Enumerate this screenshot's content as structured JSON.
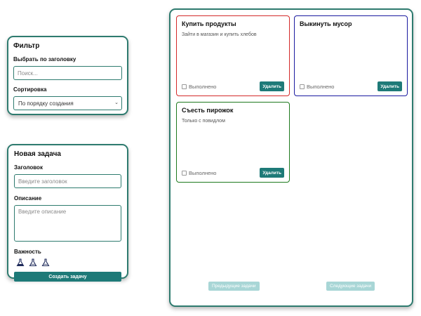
{
  "filter": {
    "title": "Фильтр",
    "search_label": "Выбрать по заголовку",
    "search_placeholder": "Поиск...",
    "sort_label": "Сортировка",
    "sort_selected": "По порядку создания"
  },
  "new_task": {
    "title": "Новая задача",
    "title_label": "Заголовок",
    "title_placeholder": "Введите заголовок",
    "desc_label": "Описание",
    "desc_placeholder": "Введите описание",
    "importance_label": "Важность",
    "importance_icons": [
      "flask-icon",
      "flask-outline-icon",
      "flask-outline-icon"
    ],
    "submit_label": "Создать задачу"
  },
  "tasks": [
    {
      "title": "Купить продукты",
      "description": "Зайти в магазин и купить хлебов",
      "done_label": "Выполнено",
      "delete_label": "Удалить",
      "border_color": "#d42a2a"
    },
    {
      "title": "Выкинуть мусор",
      "description": "",
      "done_label": "Выполнено",
      "delete_label": "Удалить",
      "border_color": "#1a1aa0"
    },
    {
      "title": "Съесть пирожок",
      "description": "Только с повидлом",
      "done_label": "Выполнено",
      "delete_label": "Удалить",
      "border_color": "#1e7a1e"
    }
  ],
  "pagination": {
    "prev_label": "Предыдущие задачи",
    "next_label": "Следующие задачи"
  },
  "colors": {
    "accent": "#1e7a78",
    "panel_border": "#2e7b6f",
    "pager_disabled": "#a8d6d6"
  }
}
